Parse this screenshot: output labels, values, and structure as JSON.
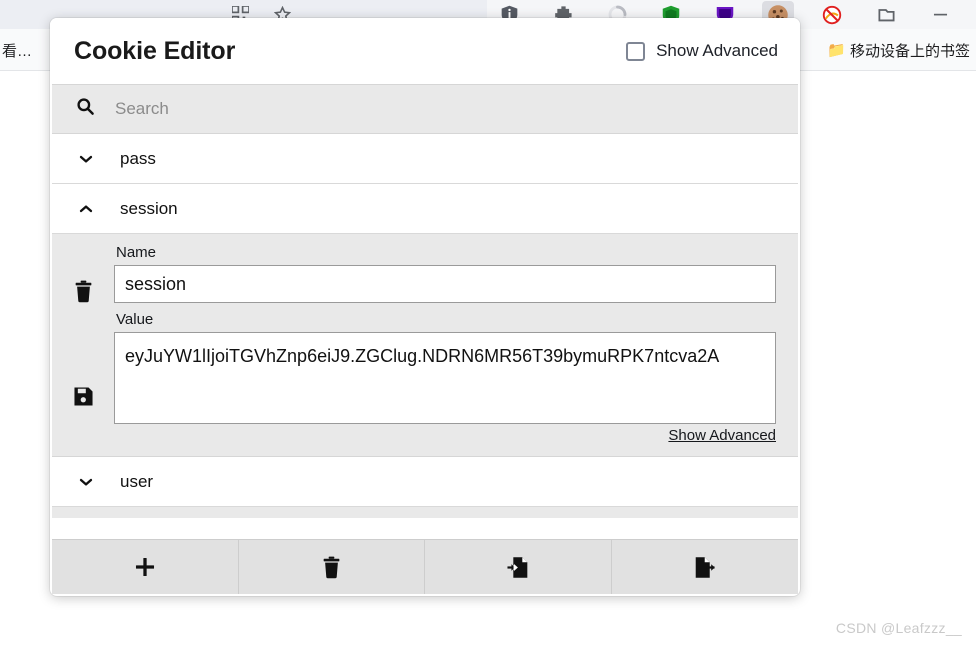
{
  "browser": {
    "toolbar_icons": [
      {
        "name": "qr-code-icon"
      },
      {
        "name": "bookmark-star-icon"
      },
      {
        "name": "shield-info-icon"
      },
      {
        "name": "puzzle-extension-icon"
      },
      {
        "name": "loading-spinner-icon"
      },
      {
        "name": "green-shield-icon"
      },
      {
        "name": "purple-shield-icon"
      },
      {
        "name": "cookie-editor-icon"
      },
      {
        "name": "blocked-icon"
      },
      {
        "name": "window-icon"
      },
      {
        "name": "minimize-icon"
      }
    ],
    "bookmarks_left_text": "看…",
    "bookmarks_right_text": "移动设备上的书签"
  },
  "popup": {
    "title": "Cookie Editor",
    "show_advanced_checkbox_label": "Show Advanced",
    "show_advanced_checked": false,
    "search": {
      "placeholder": "Search",
      "value": "",
      "icon": "search-icon"
    },
    "cookies": [
      {
        "name": "pass",
        "expanded": false,
        "chevron": "chevron-down-icon"
      },
      {
        "name": "session",
        "expanded": true,
        "chevron": "chevron-up-icon",
        "detail": {
          "name_label": "Name",
          "name_value": "session",
          "value_label": "Value",
          "value_value": "eyJuYW1lIjoiTGVhZnp6eiJ9.ZGClug.NDRN6MR56T39bymuRPK7ntcva2A",
          "delete_icon": "trash-icon",
          "save_icon": "save-floppy-icon",
          "show_advanced_link": "Show Advanced"
        }
      },
      {
        "name": "user",
        "expanded": false,
        "chevron": "chevron-down-icon"
      }
    ],
    "footer_buttons": [
      {
        "name": "add-cookie-button",
        "icon": "plus-icon"
      },
      {
        "name": "delete-all-cookies-button",
        "icon": "trash-icon"
      },
      {
        "name": "import-cookies-button",
        "icon": "import-document-icon"
      },
      {
        "name": "export-cookies-button",
        "icon": "export-document-icon"
      }
    ]
  },
  "watermark": "CSDN @Leafzzz__",
  "colors": {
    "panel_bg": "#e9e9e9",
    "footer_bg": "#e1e1e1",
    "toolbar_bg": "#eceef3",
    "accent_text": "#111111"
  }
}
